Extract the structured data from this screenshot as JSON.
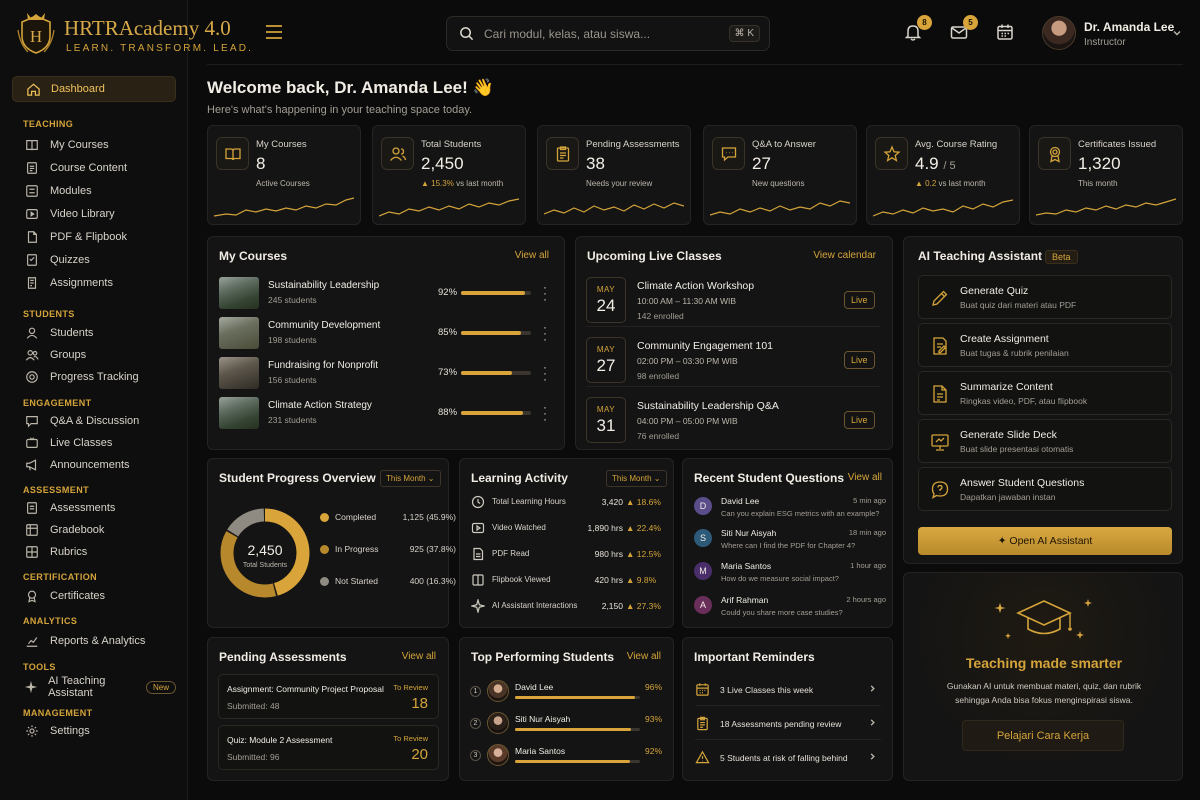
{
  "brand": {
    "name": "HRTRAcademy 4.0",
    "tagline": "LEARN. TRANSFORM. LEAD.",
    "accent": "#d4a43a"
  },
  "search": {
    "placeholder": "Cari modul, kelas, atau siswa...",
    "shortcut": "⌘ K"
  },
  "topbar": {
    "notifications": "8",
    "messages": "5"
  },
  "user": {
    "name": "Dr. Amanda Lee",
    "role": "Instructor"
  },
  "sidebar": {
    "dashboard": "Dashboard",
    "sections": {
      "teaching": "TEACHING",
      "students": "STUDENTS",
      "engagement": "ENGAGEMENT",
      "assessment": "ASSESSMENT",
      "certification": "CERTIFICATION",
      "analytics": "ANALYTICS",
      "tools": "TOOLS",
      "management": "MANAGEMENT"
    },
    "items": {
      "my_courses": "My Courses",
      "course_content": "Course Content",
      "modules": "Modules",
      "video_library": "Video Library",
      "pdf_flipbook": "PDF & Flipbook",
      "quizzes": "Quizzes",
      "assignments": "Assignments",
      "students": "Students",
      "groups": "Groups",
      "progress_tracking": "Progress Tracking",
      "qa": "Q&A & Discussion",
      "live_classes": "Live Classes",
      "announcements": "Announcements",
      "assessments": "Assessments",
      "gradebook": "Gradebook",
      "rubrics": "Rubrics",
      "certificates": "Certificates",
      "reports": "Reports & Analytics",
      "ai_assistant": "AI Teaching Assistant",
      "ai_badge": "New",
      "settings": "Settings"
    }
  },
  "welcome": {
    "title": "Welcome back, Dr. Amanda Lee! 👋",
    "subtitle": "Here's what's happening in your teaching space today."
  },
  "stats": [
    {
      "label": "My Courses",
      "value": "8",
      "sub": "Active Courses",
      "trend": ""
    },
    {
      "label": "Total Students",
      "value": "2,450",
      "sub": "vs last month",
      "trend": "▲ 15.3%"
    },
    {
      "label": "Pending Assessments",
      "value": "38",
      "sub": "Needs your review",
      "trend": ""
    },
    {
      "label": "Q&A to Answer",
      "value": "27",
      "sub": "New questions",
      "trend": ""
    },
    {
      "label": "Avg. Course Rating",
      "value": "4.9",
      "value_suffix": "/ 5",
      "sub": "vs last month",
      "trend": "▲ 0.2"
    },
    {
      "label": "Certificates Issued",
      "value": "1,320",
      "sub": "This month",
      "trend": ""
    }
  ],
  "my_courses": {
    "title": "My Courses",
    "link": "View all",
    "items": [
      {
        "name": "Sustainability Leadership",
        "students": "245 students",
        "pct": "92%",
        "progress": 0.92
      },
      {
        "name": "Community Development",
        "students": "198 students",
        "pct": "85%",
        "progress": 0.85
      },
      {
        "name": "Fundraising for Nonprofit",
        "students": "156 students",
        "pct": "73%",
        "progress": 0.73
      },
      {
        "name": "Climate Action Strategy",
        "students": "231 students",
        "pct": "88%",
        "progress": 0.88
      }
    ]
  },
  "live_classes": {
    "title": "Upcoming Live Classes",
    "link": "View calendar",
    "items": [
      {
        "month": "MAY",
        "day": "24",
        "title": "Climate Action Workshop",
        "time": "10:00 AM – 11:30 AM WIB",
        "enrolled": "142 enrolled",
        "badge": "Live"
      },
      {
        "month": "MAY",
        "day": "27",
        "title": "Community Engagement 101",
        "time": "02:00 PM – 03:30 PM WIB",
        "enrolled": "98 enrolled",
        "badge": "Live"
      },
      {
        "month": "MAY",
        "day": "31",
        "title": "Sustainability Leadership Q&A",
        "time": "04:00 PM – 05:00 PM WIB",
        "enrolled": "76 enrolled",
        "badge": "Live"
      }
    ]
  },
  "ai": {
    "title": "AI Teaching Assistant",
    "badge": "Beta",
    "actions": [
      {
        "title": "Generate Quiz",
        "sub": "Buat quiz dari materi atau PDF"
      },
      {
        "title": "Create Assignment",
        "sub": "Buat tugas & rubrik penilaian"
      },
      {
        "title": "Summarize Content",
        "sub": "Ringkas video, PDF, atau flipbook"
      },
      {
        "title": "Generate Slide Deck",
        "sub": "Buat slide presentasi otomatis"
      },
      {
        "title": "Answer Student Questions",
        "sub": "Dapatkan jawaban instan"
      }
    ],
    "open": "✦ Open AI Assistant"
  },
  "progress": {
    "title": "Student Progress Overview",
    "filter": "This Month ⌄",
    "total": "2,450",
    "total_label": "Total Students",
    "segments": [
      {
        "label": "Completed",
        "value": "1,125 (45.9%)",
        "fraction": 0.459,
        "color": "#d9a43a"
      },
      {
        "label": "In Progress",
        "value": "925 (37.8%)",
        "fraction": 0.378,
        "color": "#b8892c"
      },
      {
        "label": "Not Started",
        "value": "400 (16.3%)",
        "fraction": 0.163,
        "color": "#8f8a82"
      }
    ]
  },
  "activity": {
    "title": "Learning Activity",
    "filter": "This Month ⌄",
    "items": [
      {
        "name": "Total Learning Hours",
        "value": "3,420",
        "growth": "▲ 18.6%"
      },
      {
        "name": "Video Watched",
        "value": "1,890 hrs",
        "growth": "▲ 22.4%"
      },
      {
        "name": "PDF Read",
        "value": "980 hrs",
        "growth": "▲ 12.5%"
      },
      {
        "name": "Flipbook Viewed",
        "value": "420 hrs",
        "growth": "▲ 9.8%"
      },
      {
        "name": "AI Assistant Interactions",
        "value": "2,150",
        "growth": "▲ 27.3%"
      }
    ]
  },
  "questions": {
    "title": "Recent Student Questions",
    "link": "View all",
    "items": [
      {
        "initial": "D",
        "name": "David Lee",
        "time": "5 min ago",
        "text": "Can you explain ESG metrics with an example?",
        "color": "#5a4d8a"
      },
      {
        "initial": "S",
        "name": "Siti Nur Aisyah",
        "time": "18 min ago",
        "text": "Where can I find the PDF for Chapter 4?",
        "color": "#2e5a7a"
      },
      {
        "initial": "M",
        "name": "Maria Santos",
        "time": "1 hour ago",
        "text": "How do we measure social impact?",
        "color": "#4a2e6a"
      },
      {
        "initial": "A",
        "name": "Arif Rahman",
        "time": "2 hours ago",
        "text": "Could you share more case studies?",
        "color": "#6a2e5a"
      }
    ]
  },
  "pending": {
    "title": "Pending Assessments",
    "link": "View all",
    "items": [
      {
        "title": "Assignment: Community Project Proposal",
        "submitted": "Submitted: 48",
        "status": "To Review",
        "count": "18"
      },
      {
        "title": "Quiz: Module 2 Assessment",
        "submitted": "Submitted: 96",
        "status": "To Review",
        "count": "20"
      }
    ]
  },
  "top_students": {
    "title": "Top Performing Students",
    "link": "View all",
    "items": [
      {
        "rank": "1",
        "name": "David Lee",
        "pct": "96%",
        "progress": 0.96
      },
      {
        "rank": "2",
        "name": "Siti Nur Aisyah",
        "pct": "93%",
        "progress": 0.93
      },
      {
        "rank": "3",
        "name": "Maria Santos",
        "pct": "92%",
        "progress": 0.92
      }
    ]
  },
  "reminders": {
    "title": "Important Reminders",
    "items": [
      {
        "text": "3 Live Classes this week"
      },
      {
        "text": "18 Assessments pending review"
      },
      {
        "text": "5 Students at risk of falling behind"
      }
    ]
  },
  "promo": {
    "title": "Teaching made smarter",
    "text": "Gunakan AI untuk membuat materi, quiz, dan rubrik sehingga Anda bisa fokus menginspirasi siswa.",
    "button": "Pelajari Cara Kerja"
  }
}
